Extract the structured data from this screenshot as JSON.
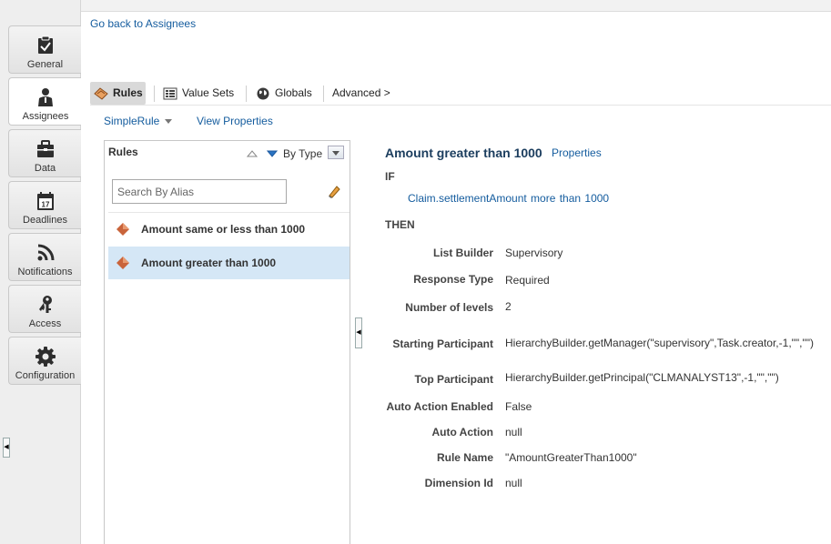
{
  "sidebar": {
    "tabs": [
      {
        "label": "General",
        "icon": "clipboard-check-icon"
      },
      {
        "label": "Assignees",
        "icon": "person-icon"
      },
      {
        "label": "Data",
        "icon": "briefcase-icon"
      },
      {
        "label": "Deadlines",
        "icon": "calendar-icon",
        "day": "17"
      },
      {
        "label": "Notifications",
        "icon": "rss-icon"
      },
      {
        "label": "Access",
        "icon": "keys-icon"
      },
      {
        "label": "Configuration",
        "icon": "gear-icon"
      }
    ],
    "active": "Assignees"
  },
  "header": {
    "back_link": "Go back to Assignees"
  },
  "toolbar": {
    "rules": "Rules",
    "value_sets": "Value Sets",
    "globals": "Globals",
    "advanced": "Advanced >"
  },
  "ruleset": {
    "name": "SimpleRule",
    "view_properties": "View Properties"
  },
  "rules_panel": {
    "title": "Rules",
    "sort_label": "By Type",
    "search_placeholder": "Search By Alias",
    "items": [
      {
        "label": "Amount same or less than 1000",
        "selected": false
      },
      {
        "label": "Amount greater than 1000",
        "selected": true
      }
    ]
  },
  "detail": {
    "title": "Amount greater than 1000",
    "properties_link": "Properties",
    "if_label": "IF",
    "condition": "Claim.settlementAmount  more than  1000",
    "then_label": "THEN",
    "fields": [
      {
        "label": "List Builder",
        "value": "Supervisory"
      },
      {
        "label": "Response Type",
        "value": "Required"
      },
      {
        "label": "Number of levels",
        "value": "2"
      },
      {
        "label": "Starting Participant",
        "value": "HierarchyBuilder.getManager(\"supervisory\",Task.creator,-1,\"\",\"\")"
      },
      {
        "label": "Top Participant",
        "value": "HierarchyBuilder.getPrincipal(\"CLMANALYST13\",-1,\"\",\"\")"
      },
      {
        "label": "Auto Action Enabled",
        "value": "False"
      },
      {
        "label": "Auto Action",
        "value": "null"
      },
      {
        "label": "Rule Name",
        "value": "\"AmountGreaterThan1000\""
      },
      {
        "label": "Dimension Id",
        "value": "null"
      }
    ]
  },
  "colors": {
    "link": "#145c9e",
    "selected_row": "#d5e7f6",
    "diamond": "#c9643b"
  }
}
